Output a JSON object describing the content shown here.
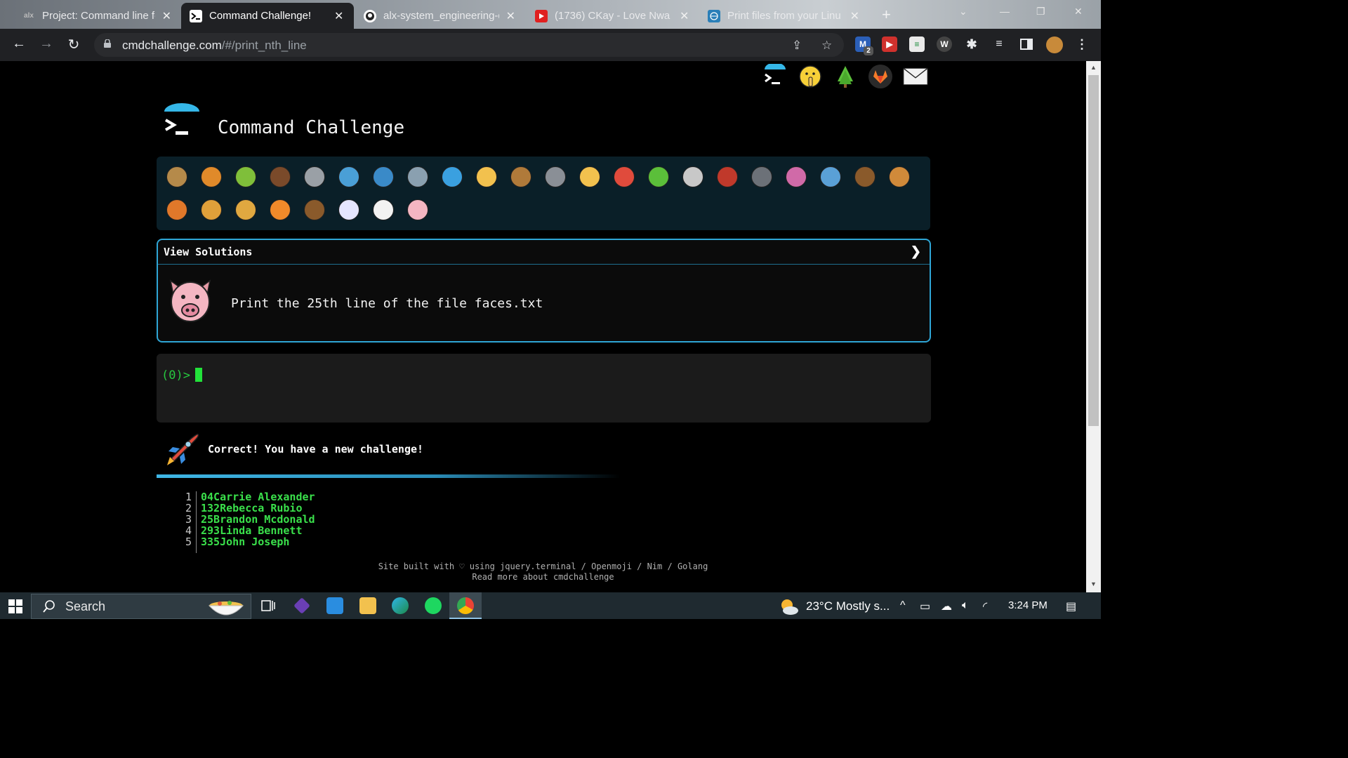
{
  "browser": {
    "tabs": [
      {
        "title": "Project: Command line fo",
        "favicon": "alx",
        "active": false
      },
      {
        "title": "Command Challenge!",
        "favicon": "terminal-icon",
        "active": true
      },
      {
        "title": "alx-system_engineering-d",
        "favicon": "github-icon",
        "active": false
      },
      {
        "title": "(1736) CKay - Love Nwa",
        "favicon": "youtube-icon",
        "active": false
      },
      {
        "title": "Print files from your Linu",
        "favicon": "globe-icon",
        "active": false
      }
    ],
    "url_host": "cmdchallenge.com",
    "url_path": "/#/print_nth_line",
    "extension_badge": "2"
  },
  "page": {
    "title": "Command Challenge",
    "animals": [
      "snail",
      "butterfly",
      "caterpillar",
      "ant",
      "spider-web",
      "whale",
      "dolphin",
      "shark",
      "fish",
      "tropical-fish",
      "blowfish",
      "wolf",
      "bee",
      "ladybug",
      "worm",
      "flea",
      "scorpion",
      "fly",
      "snake",
      "microbe",
      "monkey",
      "dog",
      "fox",
      "cat",
      "lion",
      "tiger",
      "horse",
      "unicorn",
      "cow",
      "pig"
    ],
    "challenge": {
      "header": "View Solutions",
      "description": "Print the 25th line of the file faces.txt"
    },
    "terminal": {
      "prompt": "(0)>"
    },
    "success_message": "Correct! You have a new challenge!",
    "output_lines": [
      {
        "n": "1",
        "text": "04Carrie Alexander"
      },
      {
        "n": "2",
        "text": "132Rebecca Rubio"
      },
      {
        "n": "3",
        "text": "25Brandon Mcdonald"
      },
      {
        "n": "4",
        "text": "293Linda Bennett"
      },
      {
        "n": "5",
        "text": "335John Joseph"
      }
    ],
    "footer_line1": "Site built with ♡ using jquery.terminal / Openmoji / Nim / Golang",
    "footer_line2": "Read more about cmdchallenge"
  },
  "taskbar": {
    "search_placeholder": "Search",
    "weather": "23°C  Mostly s...",
    "time": "3:24 PM"
  },
  "colors": {
    "accent": "#2fa6d6",
    "terminal_green": "#22e23a",
    "panel": "#0a1f28"
  }
}
